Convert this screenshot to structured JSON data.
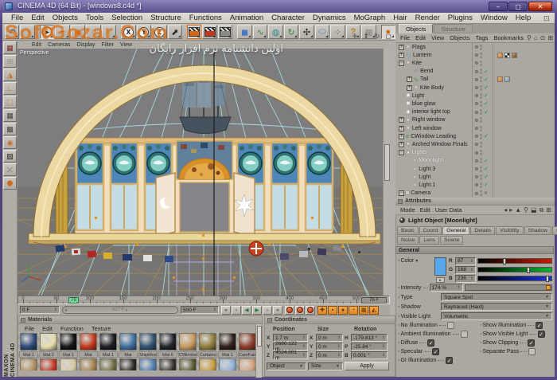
{
  "window": {
    "title": "CINEMA 4D (64 Bit) - [windows8.c4d *]",
    "controls": {
      "minimize": "–",
      "maximize": "▢",
      "close": "✕"
    }
  },
  "watermark": {
    "line1": "SoftGozar.Com",
    "line2": "اولین دانشنامه نرم افزار رایگان"
  },
  "menubar": {
    "items": [
      "File",
      "Edit",
      "Objects",
      "Tools",
      "Selection",
      "Structure",
      "Functions",
      "Animation",
      "Character",
      "Dynamics",
      "MoGraph",
      "Hair",
      "Render",
      "Plugins",
      "Window",
      "Help"
    ],
    "right_icon": "⊡"
  },
  "toolbar": {
    "tools": [
      {
        "name": "undo",
        "glyph": "↶",
        "fg": "#3a3a38"
      },
      {
        "name": "redo",
        "glyph": "↷",
        "fg": "#9a9892"
      },
      {
        "name": "sep"
      },
      {
        "name": "live-selection",
        "glyph": "➤",
        "fg": "#2a2a28",
        "ring": true,
        "pressed": true
      },
      {
        "name": "move-tool",
        "glyph": "+",
        "fg": "#d06818",
        "bold": true
      },
      {
        "name": "scale-tool",
        "glyph": "▣",
        "fg": "#d06818"
      },
      {
        "name": "rotate-tool",
        "glyph": "○",
        "fg": "#d06818",
        "bold": true
      },
      {
        "name": "last-used-tool",
        "glyph": "○",
        "fg": "#d8a818",
        "bold": true
      },
      {
        "name": "sep"
      },
      {
        "name": "lock-x-axis",
        "glyph": "X",
        "circle": true
      },
      {
        "name": "lock-y-axis",
        "glyph": "Y",
        "circle": true
      },
      {
        "name": "lock-z-axis",
        "glyph": "Z",
        "circle": true
      },
      {
        "name": "coordinate-system",
        "glyph": "⬈",
        "fg": "#2a2a28"
      },
      {
        "name": "sep"
      },
      {
        "name": "render-view",
        "clapper": "#d06818",
        "pressed": true
      },
      {
        "name": "render-settings",
        "clapper": "#c03a20"
      },
      {
        "name": "render-queue",
        "clapper": "#8a8a86"
      },
      {
        "name": "sep"
      },
      {
        "name": "add-primitive",
        "glyph": "◼",
        "fg": "#4a78c0"
      },
      {
        "name": "add-spline",
        "glyph": "∿",
        "fg": "#2e8a3a"
      },
      {
        "name": "add-generator",
        "glyph": "◍",
        "fg": "#2e8a8a"
      },
      {
        "name": "add-modeling",
        "glyph": "↻",
        "fg": "#2e8a3a"
      },
      {
        "name": "add-deformer",
        "glyph": "✣",
        "fg": "#2a2a28"
      },
      {
        "name": "add-environment",
        "glyph": "⬭",
        "fg": "#4a78c0"
      },
      {
        "name": "add-particles",
        "glyph": "⁘",
        "fg": "#55534e"
      },
      {
        "name": "help-pointer",
        "glyph": "?",
        "fg": "#c07818",
        "bold": true
      },
      {
        "name": "command-table",
        "glyph": "▦",
        "fg": "#8a8a86"
      },
      {
        "name": "sep"
      },
      {
        "name": "material-ball",
        "glyph": "●",
        "fg": "#d06818",
        "pressed": true
      }
    ]
  },
  "left_toolbar": {
    "tools": [
      {
        "name": "interactive-render-region",
        "glyph": "▦",
        "fg": "#7a2a2a"
      },
      {
        "name": "axis-locked",
        "glyph": "⊞",
        "fg": "#94928c"
      },
      {
        "name": "make-editable",
        "glyph": "◮",
        "fg": "#d06818"
      },
      {
        "name": "object-axis-mode",
        "glyph": "∟",
        "fg": "#d06818"
      },
      {
        "name": "points-mode",
        "glyph": "⬚",
        "fg": "#d06818"
      },
      {
        "name": "edges-mode",
        "glyph": "▦",
        "fg": "#44423e"
      },
      {
        "name": "polygons-mode",
        "glyph": "▩",
        "fg": "#44423e"
      },
      {
        "name": "texture-mode",
        "glyph": "◉",
        "fg": "#c07030"
      },
      {
        "name": "texture-axis-mode",
        "glyph": "▨",
        "fg": "#22201c"
      },
      {
        "name": "snap-settings",
        "glyph": "⤬",
        "fg": "#44423e"
      },
      {
        "name": "model-mode",
        "glyph": "⬣",
        "fg": "#d06818"
      }
    ]
  },
  "branding": {
    "maxon": "MAXON",
    "cinema": "CINEMA 4D"
  },
  "viewport": {
    "menu": [
      "Edit",
      "Cameras",
      "Display",
      "Filter",
      "View"
    ],
    "label": "Perspective",
    "nav": [
      {
        "name": "viewport-move",
        "glyph": "✛"
      },
      {
        "name": "viewport-zoom",
        "glyph": "⇕"
      },
      {
        "name": "viewport-rotate",
        "glyph": "↻"
      },
      {
        "name": "viewport-maximize",
        "glyph": "▢"
      }
    ]
  },
  "timeline": {
    "ticks": [
      0,
      50,
      100,
      150,
      200,
      250,
      300,
      350,
      400,
      450,
      500
    ],
    "marker": "75",
    "current": "75 F",
    "start": "0 F",
    "end": "500 F",
    "range": "527 F",
    "transport": [
      {
        "name": "goto-start",
        "glyph": "«"
      },
      {
        "name": "previous-key",
        "glyph": "‹"
      },
      {
        "name": "play-backwards",
        "glyph": "◀",
        "green": true
      },
      {
        "name": "play-forwards",
        "glyph": "▶",
        "green": true
      },
      {
        "name": "next-key",
        "glyph": "›"
      },
      {
        "name": "goto-end",
        "glyph": "»"
      }
    ],
    "record_buttons": [
      {
        "name": "record-position"
      },
      {
        "name": "record-scale"
      },
      {
        "name": "record-rotation"
      }
    ],
    "key_buttons": [
      {
        "name": "record-keyframe",
        "glyph": "✚"
      },
      {
        "name": "autokeying",
        "glyph": "▪"
      },
      {
        "name": "keyframe-selection",
        "glyph": "●"
      },
      {
        "name": "playback-clock",
        "glyph": "◔"
      },
      {
        "name": "keyframe-presets",
        "glyph": "▦"
      },
      {
        "name": "sound-toggle",
        "glyph": "◭"
      }
    ]
  },
  "materials": {
    "title": "Materials",
    "menu": [
      "File",
      "Edit",
      "Function",
      "Texture"
    ],
    "items": [
      {
        "label": "Mat 1",
        "color": "#2e4a7a"
      },
      {
        "label": "Mat 2",
        "color": "#e6ddad"
      },
      {
        "label": "Mat 1",
        "color": "#141414"
      },
      {
        "label": "Mat",
        "color": "#c23a20"
      },
      {
        "label": "Mat 1",
        "color": "#1c1c22"
      },
      {
        "label": "Mat",
        "color": "#3e6f9e"
      },
      {
        "label": "ShipMod",
        "color": "#31506e"
      },
      {
        "label": "Mat 6",
        "color": "#20242a"
      },
      {
        "label": "CWindow",
        "color": "#c89a5e"
      },
      {
        "label": "Curtains",
        "color": "#8f7d3a"
      },
      {
        "label": "Mat 1",
        "color": "#2e2018"
      },
      {
        "label": "CamFabr",
        "color": "#8c3e2a"
      }
    ],
    "row2_colors": [
      "#b29060",
      "#c03624",
      "#d9c9a4",
      "#a57f4e",
      "#6d6b42",
      "#2b2b28",
      "#4f7cae",
      "#33312c",
      "#575a36",
      "#c79d3f",
      "#8fb2d6",
      "#d2a27e"
    ]
  },
  "coordinates": {
    "title": "Coordinates",
    "headers": [
      "Position",
      "Size",
      "Rotation"
    ],
    "position": {
      "labels": [
        "X",
        "Y",
        "Z"
      ],
      "values": [
        "1.7 m",
        "2680.122 m",
        "4524.001 m"
      ]
    },
    "size": {
      "labels": [
        "X",
        "Y",
        "Z"
      ],
      "values": [
        "0 m",
        "0 m",
        "0 m"
      ]
    },
    "rotation": {
      "labels": [
        "H",
        "P",
        "B"
      ],
      "values": [
        "-179.813 °",
        "-25.84 °",
        "0.001 °"
      ]
    },
    "mode_object": "Object",
    "mode_size": "Size",
    "apply": "Apply"
  },
  "objects_panel": {
    "tabs": [
      "Objects",
      "Structure"
    ],
    "active_tab": "Objects",
    "menu": [
      "File",
      "Edit",
      "View",
      "Objects",
      "Tags",
      "Bookmarks"
    ],
    "header_icons": [
      {
        "name": "search-icon",
        "glyph": "⚲"
      },
      {
        "name": "home-icon",
        "glyph": "⌂"
      },
      {
        "name": "eye-icon",
        "glyph": "⊙"
      },
      {
        "name": "add-panel-icon",
        "glyph": "⊞"
      }
    ],
    "tree": [
      {
        "label": "Flags",
        "depth": 0,
        "expand": "+",
        "icon": "object"
      },
      {
        "label": "Lantern",
        "depth": 0,
        "expand": "+",
        "icon": "object-blue",
        "tags": [
          "phong",
          "checker",
          "texture"
        ]
      },
      {
        "label": "Kite",
        "depth": 0,
        "expand": "-",
        "icon": "object"
      },
      {
        "label": "Bend",
        "depth": 1,
        "icon": "bend",
        "check": true
      },
      {
        "label": "Tail",
        "depth": 1,
        "expand": "+",
        "icon": "spline",
        "check": true,
        "tags": [
          "phong",
          "feather"
        ]
      },
      {
        "label": "Kite Body",
        "depth": 1,
        "expand": "+",
        "icon": "object",
        "check": true
      },
      {
        "label": "Light",
        "depth": 0,
        "icon": "light",
        "check": true
      },
      {
        "label": "blue glow",
        "depth": 0,
        "icon": "light",
        "check": true
      },
      {
        "label": "interior light top",
        "depth": 0,
        "icon": "light",
        "check": true
      },
      {
        "label": "Right window",
        "depth": 0,
        "expand": "+",
        "icon": "object"
      },
      {
        "label": "Left window",
        "depth": 0,
        "expand": "+",
        "icon": "object"
      },
      {
        "label": "CWindow Leading",
        "depth": 0,
        "expand": "+",
        "icon": "object-green",
        "check": true
      },
      {
        "label": "Arched Window Finals",
        "depth": 0,
        "expand": "+",
        "icon": "object"
      },
      {
        "label": "Lights",
        "depth": 0,
        "expand": "-",
        "icon": "object",
        "selected": true
      },
      {
        "label": "Moonlight",
        "depth": 1,
        "icon": "light-spot",
        "check": true,
        "selected": true
      },
      {
        "label": "Light 3",
        "depth": 1,
        "icon": "light-spot",
        "check": true
      },
      {
        "label": "Light",
        "depth": 1,
        "icon": "light-spot",
        "check": true
      },
      {
        "label": "Light.1",
        "depth": 1,
        "icon": "light-spot",
        "check": true
      },
      {
        "label": "Camera",
        "depth": 0,
        "expand": "-",
        "icon": "camera",
        "cross": true
      }
    ]
  },
  "attributes": {
    "title": "Attributes",
    "menu": [
      "Mode",
      "Edit",
      "User Data"
    ],
    "header_icons": [
      {
        "name": "history-back-icon",
        "glyph": "◂"
      },
      {
        "name": "history-forward-icon",
        "glyph": "▸"
      },
      {
        "name": "filter-icon",
        "glyph": "▲"
      },
      {
        "name": "search-icon",
        "glyph": "⚲"
      },
      {
        "name": "lock-icon",
        "glyph": "⬓"
      },
      {
        "name": "compare-icon",
        "glyph": "⧉"
      },
      {
        "name": "new-panel-icon",
        "glyph": "⊞"
      }
    ],
    "object_label": "Light Object [Moonlight]",
    "tabs_row1": [
      "Basic",
      "Coord",
      "General",
      "Details",
      "Visibility",
      "Shadow",
      "Caustics"
    ],
    "tabs_row2": [
      "Noise",
      "Lens",
      "Scene"
    ],
    "active_tab": "General",
    "section": "General",
    "color": {
      "label": "Color",
      "swatch": "#57a8ec",
      "rows": [
        {
          "ch": "R",
          "val": "87",
          "grad": "#cc1a00",
          "pos": 34
        },
        {
          "ch": "G",
          "val": "168",
          "grad": "#00b830",
          "pos": 66
        },
        {
          "ch": "B",
          "val": "236",
          "grad": "#1a30e0",
          "pos": 92
        }
      ]
    },
    "intensity": {
      "label": "Intensity",
      "value": "174 %"
    },
    "type": {
      "label": "Type",
      "value": "Square Spot"
    },
    "shadow": {
      "label": "Shadow",
      "value": "Raytraced (Hard)"
    },
    "visible_light": {
      "label": "Visible Light",
      "value": "Volumetric"
    },
    "checkboxes_left": [
      {
        "label": "No Illumination",
        "checked": false
      },
      {
        "label": "Ambient Illumination",
        "checked": false
      },
      {
        "label": "Diffuse",
        "checked": true
      },
      {
        "label": "Specular",
        "checked": true
      },
      {
        "label": "GI Illumination",
        "checked": true
      }
    ],
    "checkboxes_right": [
      {
        "label": "Show Illumination",
        "checked": true
      },
      {
        "label": "Show Visible Light",
        "checked": true
      },
      {
        "label": "Show Clipping",
        "checked": true
      },
      {
        "label": "Separate Pass",
        "checked": false
      }
    ]
  }
}
